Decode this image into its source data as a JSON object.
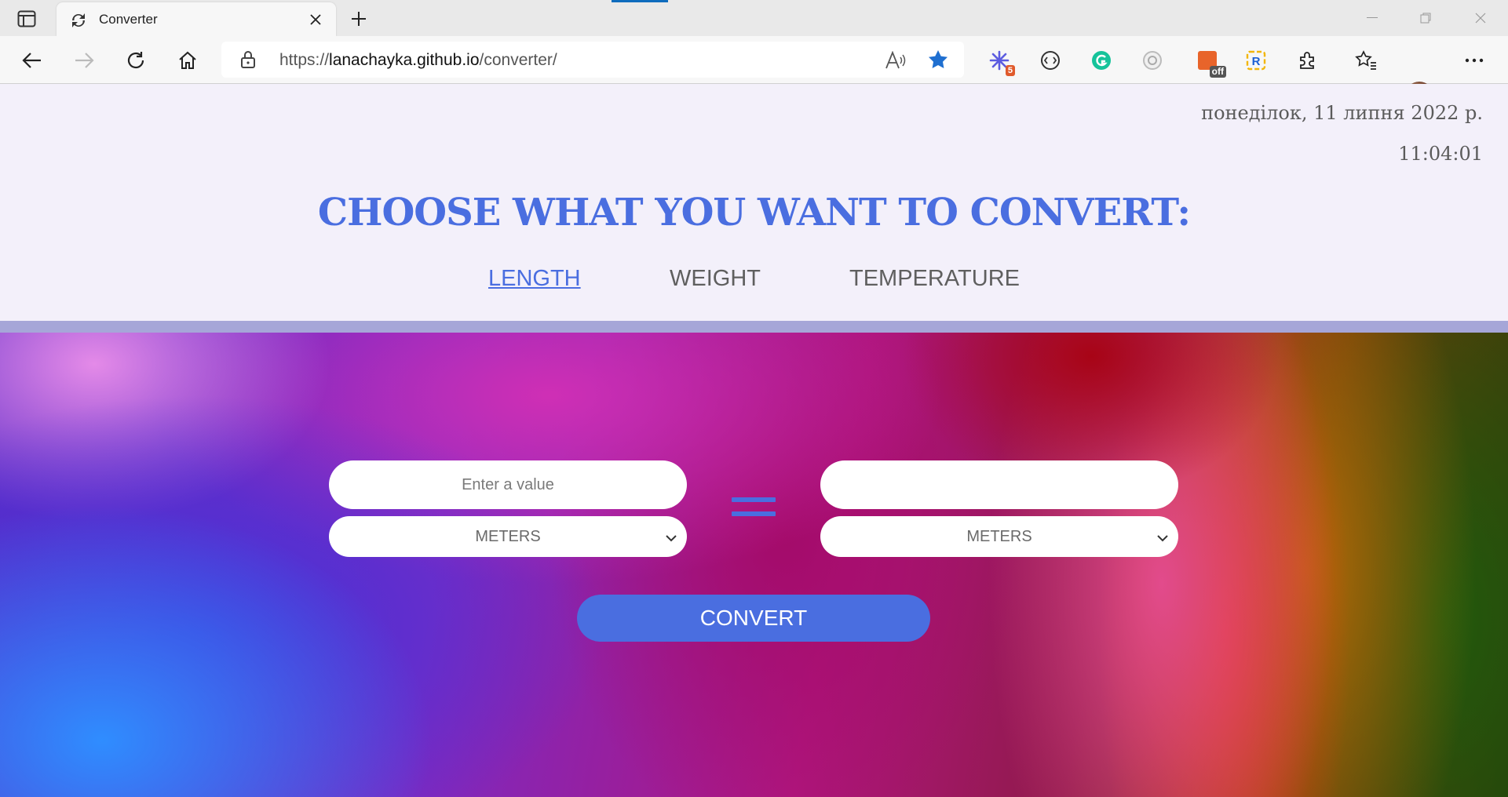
{
  "browser": {
    "tab_title": "Converter",
    "url_prefix": "https://",
    "url_host": "lanachayka.github.io",
    "url_path": "/converter/",
    "extensions": [
      {
        "name": "asterisk-extension-icon",
        "badge": "5"
      },
      {
        "name": "code-extension-icon"
      },
      {
        "name": "grammarly-extension-icon"
      },
      {
        "name": "camera-extension-icon"
      },
      {
        "name": "off-extension-icon",
        "badge": "off"
      },
      {
        "name": "r-extension-icon",
        "text": "R"
      }
    ]
  },
  "page": {
    "date": "понеділок, 11 липня 2022 р.",
    "time": "11:04:01",
    "heading": "CHOOSE WHAT YOU WANT TO CONVERT:",
    "nav": [
      "LENGTH",
      "WEIGHT",
      "TEMPERATURE"
    ],
    "active_nav": "LENGTH",
    "converter": {
      "input_placeholder": "Enter a value",
      "output_value": "",
      "from_unit": "METERS",
      "to_unit": "METERS",
      "convert_label": "CONVERT"
    }
  },
  "colors": {
    "accent": "#4a6ee0",
    "band": "#a6a6d8",
    "page_bg": "#f3f0fa"
  }
}
